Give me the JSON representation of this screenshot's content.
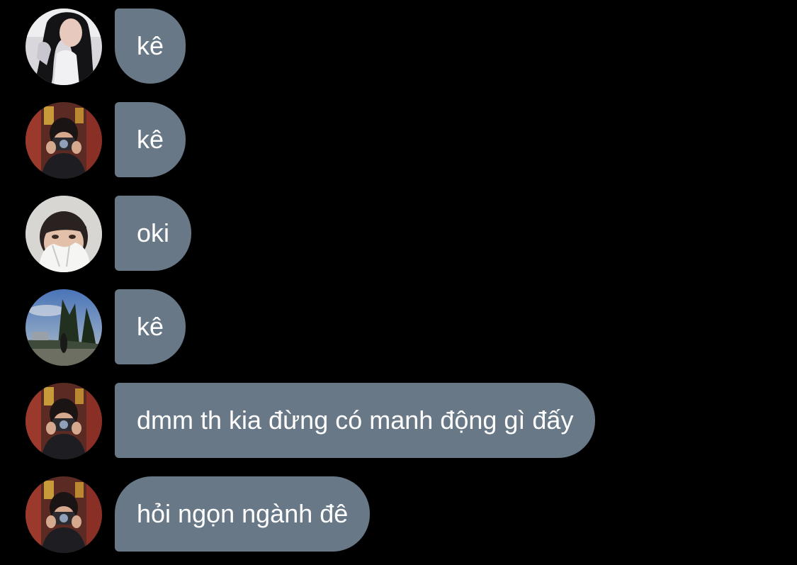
{
  "messages": [
    {
      "sender_avatar": "avatar-girl-long-hair",
      "text": "kê"
    },
    {
      "sender_avatar": "avatar-camera-selfie",
      "text": "kê"
    },
    {
      "sender_avatar": "avatar-hooded-face",
      "text": "oki"
    },
    {
      "sender_avatar": "avatar-trees-sky",
      "text": "kê"
    },
    {
      "sender_avatar": "avatar-camera-selfie",
      "text": "dmm th kia đừng có manh động gì đấy"
    },
    {
      "sender_avatar": "avatar-camera-selfie",
      "text": "hỏi ngọn ngành đê"
    }
  ],
  "colors": {
    "background": "#000000",
    "bubble": "#687887",
    "bubble_text": "#ffffff"
  }
}
